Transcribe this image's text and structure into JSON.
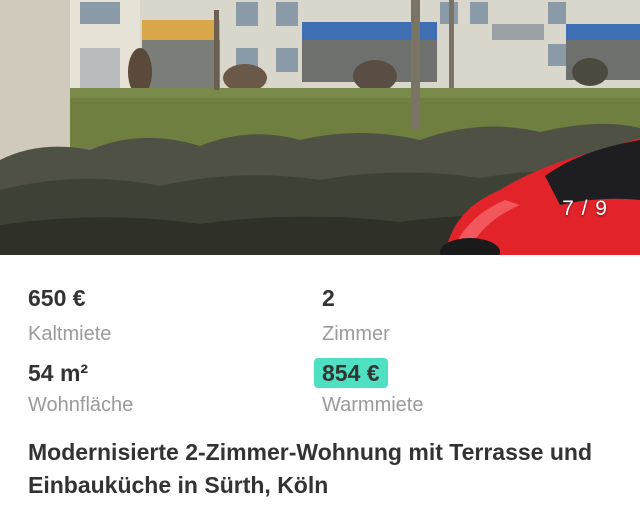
{
  "gallery": {
    "counter": "7 / 9"
  },
  "facts": {
    "cold_rent": {
      "value": "650 €",
      "label": "Kaltmiete"
    },
    "rooms": {
      "value": "2",
      "label": "Zimmer"
    },
    "living_area": {
      "value": "54 m²",
      "label": "Wohnfläche"
    },
    "warm_rent": {
      "value": "854 €",
      "label": "Warmmiete"
    }
  },
  "listing": {
    "title": "Modernisierte 2-Zimmer-Wohnung mit Terrasse und Einbauküche in Sürth, Köln"
  },
  "colors": {
    "highlight": "#4fe0c1",
    "text_primary": "#333333",
    "text_secondary": "#9a9a9a"
  }
}
